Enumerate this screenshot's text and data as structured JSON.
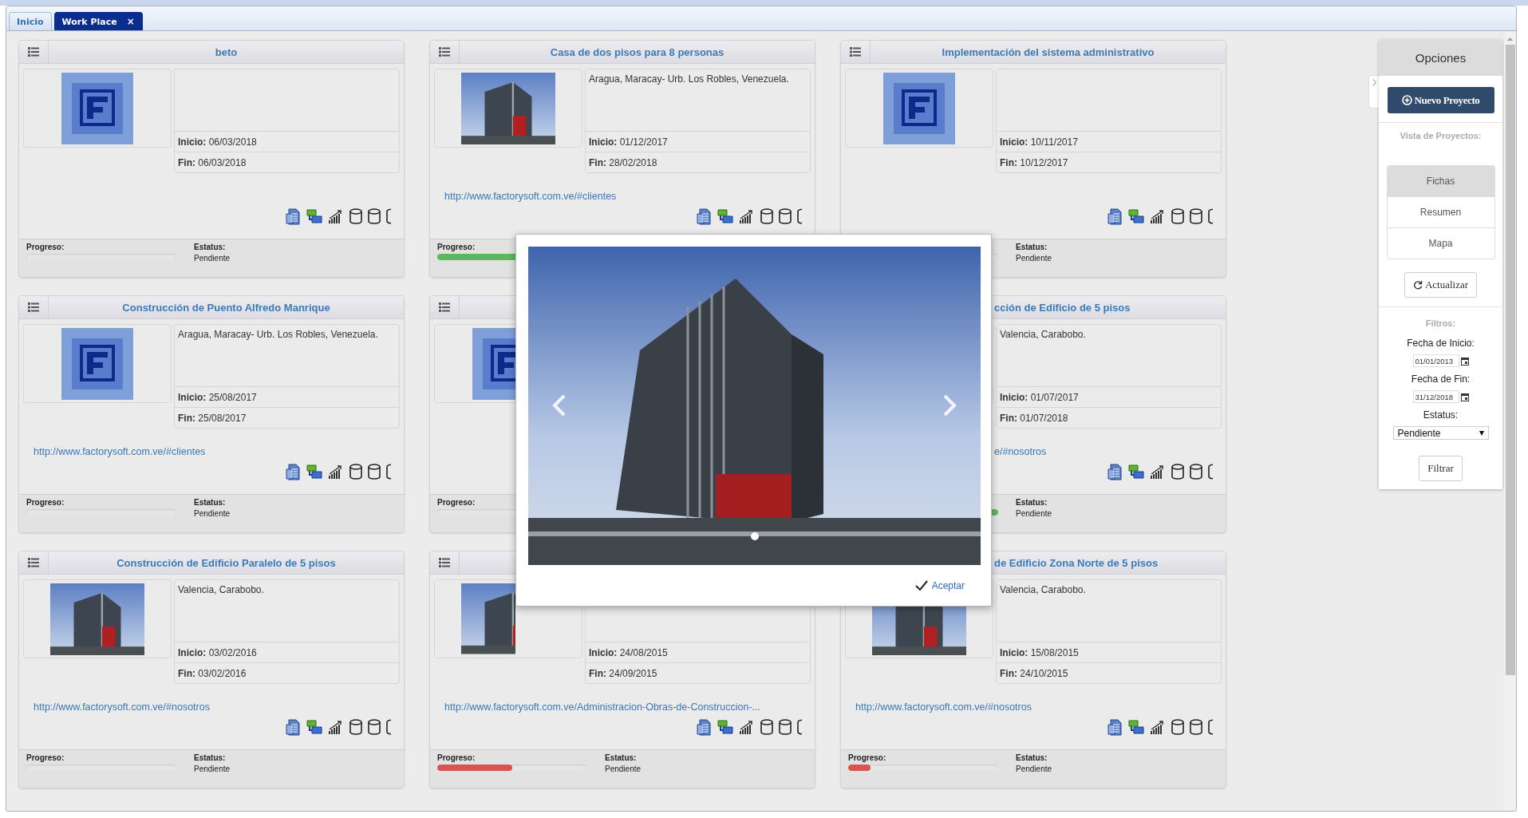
{
  "tabs": [
    {
      "label": "Inicio",
      "selected": false
    },
    {
      "label": "Work Place",
      "selected": true,
      "close": "×"
    }
  ],
  "projects": [
    {
      "title": "beto",
      "image": {
        "kind": "logo"
      },
      "start": "**Inicio:** 06/03/2018",
      "end": "**Fin:** 06/03/2018",
      "progress": {
        "label": "Progreso:"
      },
      "status": {
        "label": "Estatus:",
        "value": "Pendiente"
      }
    },
    {
      "title": "Casa de dos pisos para 8 personas",
      "image": {
        "kind": "photo"
      },
      "description": "Aragua, Maracay- Urb. Los Robles, Venezuela.",
      "start": "**Inicio:** 01/12/2017",
      "end": "**Fin:** 28/02/2018",
      "link": "http://www.factorysoft.com.ve/#clientes",
      "progress": {
        "label": "Progreso:",
        "level": 1,
        "color": "#5cb85c"
      }
    },
    {
      "title": "Implementación del sistema administrativo",
      "image": {
        "kind": "logo"
      },
      "start": "**Inicio:** 10/11/2017",
      "end": "**Fin:** 10/12/2017",
      "status": {
        "label": "Estatus:",
        "value": "Pendiente"
      }
    },
    {
      "title": "Construcción de Puento Alfredo Manrique",
      "image": {
        "kind": "logo"
      },
      "description": "Aragua, Maracay- Urb. Los Robles, Venezuela.",
      "start": "**Inicio:** 25/08/2017",
      "end": "**Fin:** 25/08/2017",
      "link": "http://www.factorysoft.com.ve/#clientes",
      "progress": {
        "label": "Progreso:"
      },
      "status": {
        "label": "Estatus:",
        "value": "Pendiente"
      }
    },
    {
      "image": {
        "kind": "logo"
      },
      "progress": {
        "label": "Progreso:"
      }
    },
    {
      "title": "cción de Edificio de 5 pisos",
      "description": "Valencia, Carabobo.",
      "start": "**Inicio:** 01/07/2017",
      "end": "**Fin:** 01/07/2018",
      "link": "e/#nosotros",
      "progress": {
        "level": 1,
        "color": "#5cb85c"
      },
      "status": {
        "label": "Estatus:",
        "value": "Pendiente"
      }
    },
    {
      "title": "Construcción de Edificio Paralelo de 5 pisos",
      "image": {
        "kind": "photo"
      },
      "description": "Valencia, Carabobo.",
      "start": "**Inicio:** 03/02/2016",
      "end": "**Fin:** 03/02/2016",
      "link": "http://www.factorysoft.com.ve/#nosotros",
      "progress": {
        "label": "Progreso:"
      },
      "status": {
        "label": "Estatus:",
        "value": "Pendiente"
      }
    },
    {
      "image": {
        "kind": "photo"
      },
      "start": "**Inicio:** 24/08/2015",
      "end": "**Fin:** 24/09/2015",
      "link": "http://www.factorysoft.com.ve/Administracion-Obras-de-Construccion-...",
      "progress": {
        "label": "Progreso:",
        "level": 0.5,
        "color": "#d9534f"
      },
      "status": {
        "label": "Estatus:",
        "value": "Pendiente"
      }
    },
    {
      "title": "de Edificio Zona Norte de 5 pisos",
      "image": {
        "kind": "photo"
      },
      "description": "Valencia, Carabobo.",
      "start": "**Inicio:** 15/08/2015",
      "end": "**Fin:** 24/10/2015",
      "link": "http://www.factorysoft.com.ve/#nosotros",
      "progress": {
        "label": "Progreso:",
        "level": 0.15,
        "color": "#d9534f"
      },
      "status": {
        "label": "Estatus:",
        "value": "Pendiente"
      }
    }
  ],
  "options": {
    "title": "Opciones",
    "new_project": "Nuevo Proyecto",
    "views_label": "Vista de Proyectos:",
    "views": [
      {
        "label": "Fichas",
        "selected": true
      },
      {
        "label": "Resumen",
        "selected": false
      },
      {
        "label": "Mapa",
        "selected": false
      }
    ],
    "refresh": "Actualizar",
    "filters_label": "Filtros:",
    "start_label": "Fecha de Inicio:",
    "start_value": "01/01/2013",
    "end_label": "Fecha de Fin:",
    "end_value": "31/12/2018",
    "status_label": "Estatus:",
    "status_value": "Pendiente",
    "filter_button": "Filtrar"
  },
  "modal": {
    "accept": "Aceptar"
  }
}
